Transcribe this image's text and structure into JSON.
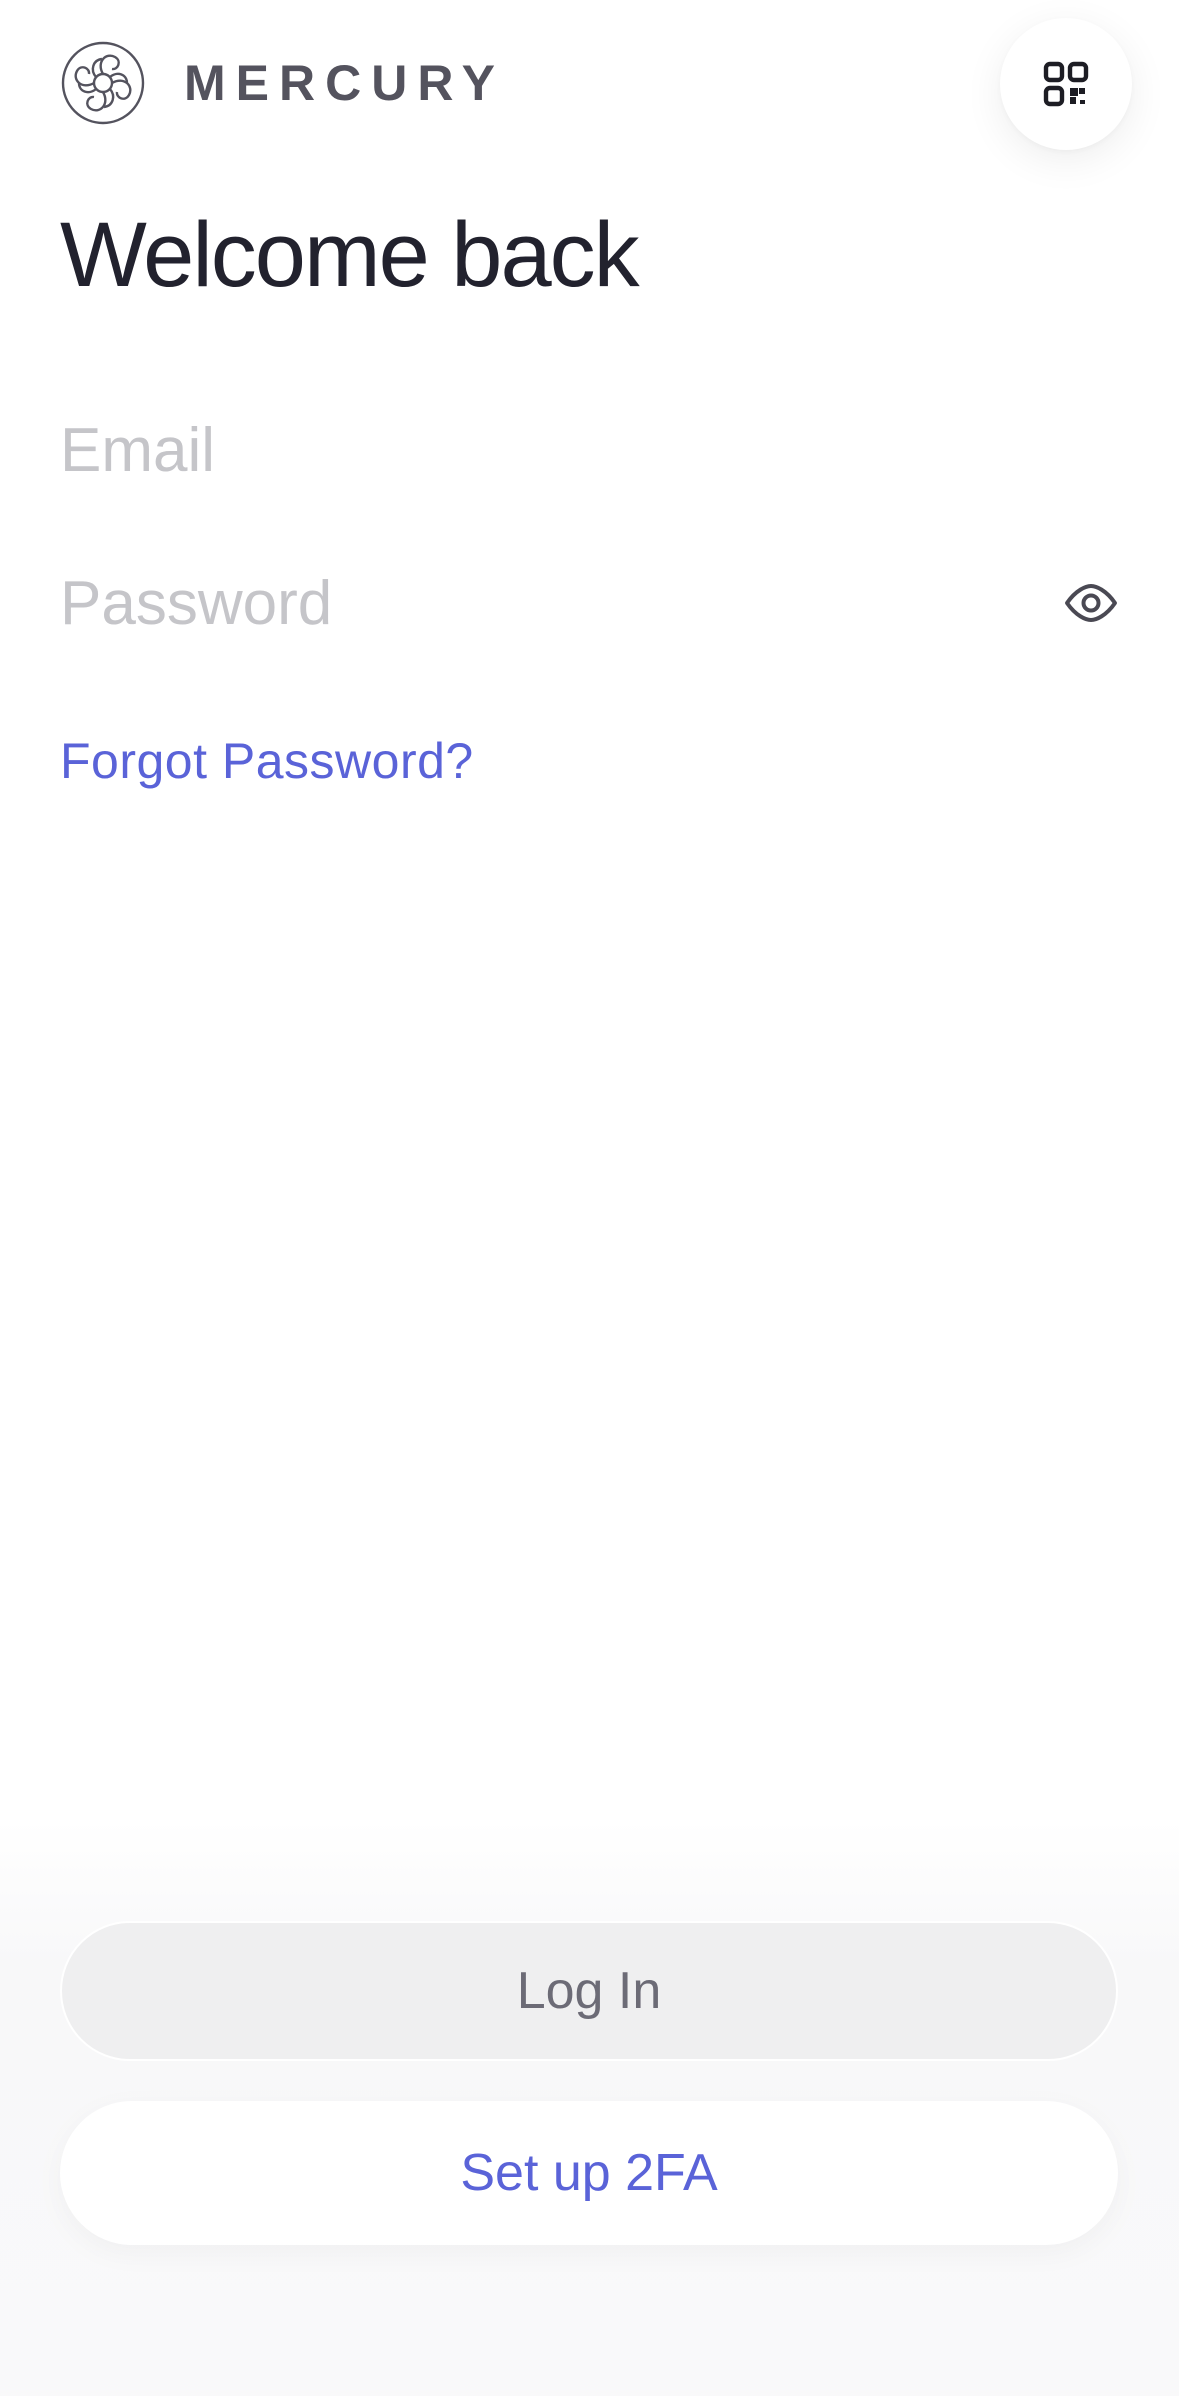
{
  "header": {
    "brand_name": "MERCURY",
    "logo_icon": "mercury-logo-icon",
    "qr_icon": "qr-code-icon"
  },
  "main": {
    "title": "Welcome back",
    "email": {
      "placeholder": "Email",
      "value": ""
    },
    "password": {
      "placeholder": "Password",
      "value": ""
    },
    "show_password_icon": "eye-icon",
    "forgot_password_label": "Forgot Password?"
  },
  "footer": {
    "login_label": "Log In",
    "setup_2fa_label": "Set up 2FA"
  },
  "colors": {
    "accent": "#5a63d8",
    "title": "#22222e",
    "placeholder": "#c5c5c9",
    "disabled_button_bg": "#efeff0",
    "disabled_button_text": "#6c6b76"
  }
}
